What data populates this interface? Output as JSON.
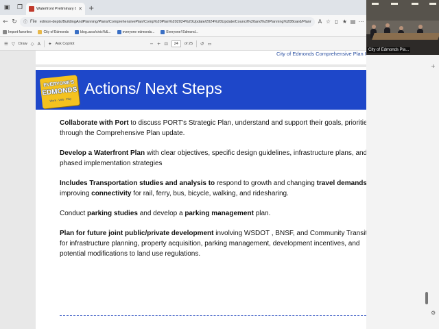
{
  "browser": {
    "tab_title": "Waterfront Preliminary Concept...",
    "address_prefix": "File",
    "url": "edmon-depts/BuildingAndPlanning/Plans/ComprehensivePlan/Comp%20Plan%202024%20Update/2024%20Update/Council%20and%20Planning%20Board/Planning%20Board/2024/Sept/Waterfront%20Preli...",
    "favorites": [
      {
        "label": "Import favorites",
        "icon": "import-icon"
      },
      {
        "label": "City of Edmonds",
        "icon": "folder-icon"
      },
      {
        "label": "blog.ucos/civic%&...",
        "icon": "page-icon"
      },
      {
        "label": "everyone edmonds...",
        "icon": "page-icon"
      },
      {
        "label": "Everyone! Edmond...",
        "icon": "page-icon"
      }
    ],
    "pdf_toolbar": {
      "draw_label": "Draw",
      "copilot_label": "Ask Copilot",
      "page_current": "24",
      "page_total": "of 25"
    }
  },
  "video": {
    "label": "City of Edmonds Pla..."
  },
  "document": {
    "prev_page_footer": "City of Edmonds Comprehensive Plan Update",
    "logo": {
      "line1": "EVERYONE'S",
      "line2": "EDMONDS",
      "tagline": "Work · Visit · Play"
    },
    "slide_title": "Actions/ Next Steps",
    "paragraphs": [
      {
        "segments": [
          {
            "t": "Collaborate with  Port",
            "b": true
          },
          {
            "t": " to discuss PORT's Strategic Plan, understand and support their goals,  priorities through the Comprehensive Plan update.",
            "b": false
          }
        ]
      },
      {
        "segments": [
          {
            "t": "Develop a Waterfront Plan",
            "b": true
          },
          {
            "t": " with clear objectives, specific design guidelines, infrastructure plans, and phased implementation strategies",
            "b": false
          }
        ]
      },
      {
        "segments": [
          {
            "t": "Includes Transportation studies and analysis to",
            "b": true
          },
          {
            "t": " respond to growth and changing ",
            "b": false
          },
          {
            "t": "travel demands",
            "b": true
          },
          {
            "t": ", improving ",
            "b": false
          },
          {
            "t": "connectivity",
            "b": true
          },
          {
            "t": " for rail, ferry, bus, bicycle, walking, and ridesharing.",
            "b": false
          }
        ]
      },
      {
        "segments": [
          {
            "t": "Conduct ",
            "b": false
          },
          {
            "t": "parking studies",
            "b": true
          },
          {
            "t": " and develop a ",
            "b": false
          },
          {
            "t": "parking management",
            "b": true
          },
          {
            "t": " plan.",
            "b": false
          }
        ]
      },
      {
        "segments": [
          {
            "t": "Plan for future joint public/private development",
            "b": true
          },
          {
            "t": " involving WSDOT , BNSF, and Community Transit for infrastructure planning, property acquisition, parking management, development incentives, and potential modifications to land use regulations.",
            "b": false
          }
        ]
      }
    ]
  },
  "colors": {
    "header_band": "#1e47c9",
    "logo_yellow": "#f4c21f",
    "footer_link": "#2a4fa0"
  }
}
